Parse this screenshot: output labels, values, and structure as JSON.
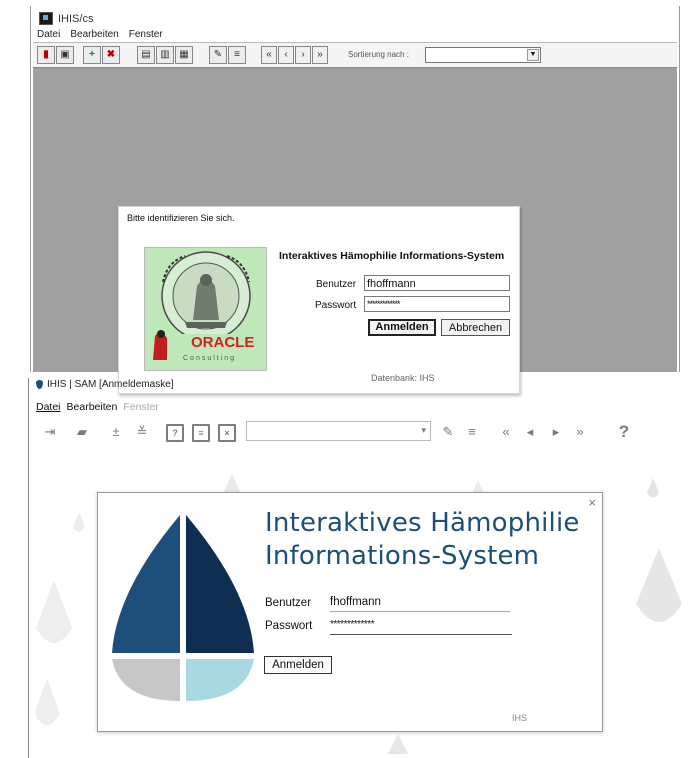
{
  "old_app": {
    "window_title": "IHIS/cs",
    "menu": [
      "Datei",
      "Bearbeiten",
      "Fenster"
    ],
    "sort_label": "Sortierung nach :",
    "sort_value": "",
    "dialog": {
      "prompt": "Bitte identifizieren Sie sich.",
      "heading": "Interaktives Hämophilie Informations-System",
      "user_label": "Benutzer",
      "user_value": "fhoffmann",
      "password_label": "Passwort",
      "password_value": "*************",
      "login_button": "Anmelden",
      "cancel_button": "Abbrechen",
      "database": "Datenbank: IHS",
      "logo_text": "ORACLE",
      "logo_subtext": "Consulting",
      "seal_text": "FACULTAS MEDICINA"
    }
  },
  "new_app": {
    "window_title": "IHIS | SAM [Anmeldemaske]",
    "menu": [
      "Datei",
      "Bearbeiten",
      "Fenster"
    ],
    "help_icon": "?",
    "dialog": {
      "heading_line1": "Interaktives Hämophilie",
      "heading_line2": "Informations-System",
      "user_label": "Benutzer",
      "user_value": "fhoffmann",
      "password_label": "Passwort",
      "password_value": "*************",
      "login_button": "Anmelden",
      "database": "IHS",
      "close_icon": "×"
    }
  },
  "colors": {
    "brand_dark": "#1d4f7a",
    "brand_navy": "#0e2f52",
    "brand_light": "#a9d8e0",
    "brand_gray": "#c7c7c7",
    "gray_backdrop": "#a0a0a0",
    "oracle_red": "#d32020"
  }
}
